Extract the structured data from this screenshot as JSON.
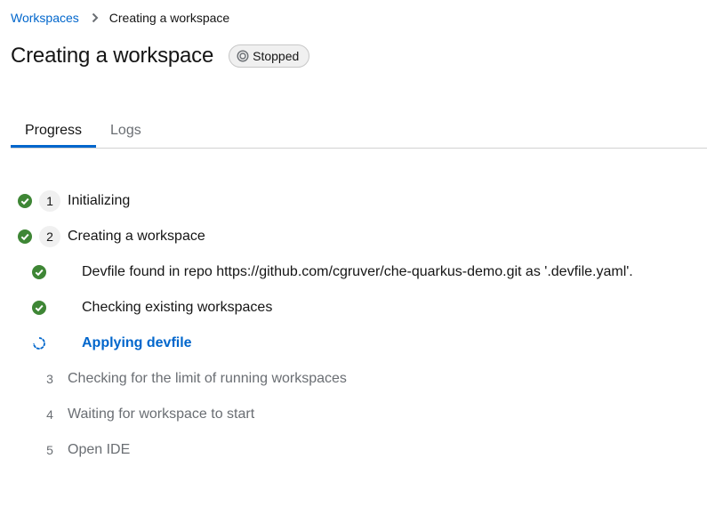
{
  "breadcrumb": {
    "root": "Workspaces",
    "current": "Creating a workspace"
  },
  "header": {
    "title": "Creating a workspace",
    "status": "Stopped"
  },
  "tabs": [
    {
      "label": "Progress",
      "active": true
    },
    {
      "label": "Logs",
      "active": false
    }
  ],
  "steps": [
    {
      "number": "1",
      "label": "Initializing",
      "state": "done"
    },
    {
      "number": "2",
      "label": "Creating a workspace",
      "state": "done"
    },
    {
      "label": "Devfile found in repo https://github.com/cgruver/che-quarkus-demo.git as '.devfile.yaml'.",
      "state": "done"
    },
    {
      "label": "Checking existing workspaces",
      "state": "done"
    },
    {
      "label": "Applying devfile",
      "state": "in-progress"
    },
    {
      "number": "3",
      "label": "Checking for the limit of running workspaces",
      "state": "pending"
    },
    {
      "number": "4",
      "label": "Waiting for workspace to start",
      "state": "pending"
    },
    {
      "number": "5",
      "label": "Open IDE",
      "state": "pending"
    }
  ],
  "colors": {
    "accent": "#0066cc",
    "success": "#3e8635",
    "pending_text": "#6a6e73"
  },
  "icons": {
    "breadcrumb_separator": "chevron-right-icon",
    "status_badge": "stopped-icon",
    "done": "check-circle-icon",
    "in_progress": "spinner-icon"
  }
}
